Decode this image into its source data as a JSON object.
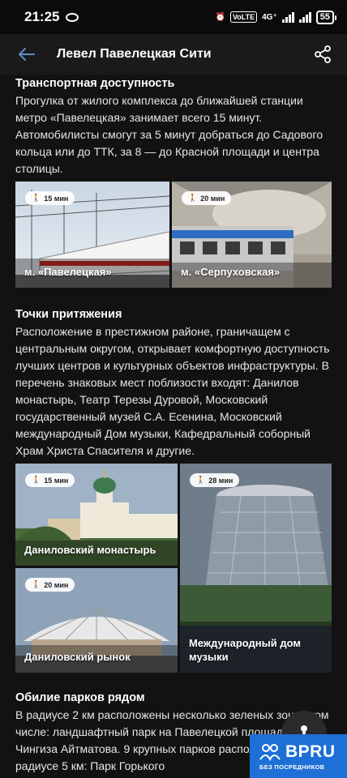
{
  "status_bar": {
    "time": "21:25",
    "volte": "VoLTE",
    "network": "4G⁺",
    "battery": "55"
  },
  "app_bar": {
    "title": "Левел Павелецкая Сити"
  },
  "transport": {
    "title": "Транспортная доступность",
    "text": "Прогулка от жилого комплекса до ближайшей станции метро «Павелецкая» занимает всего 15 минут. Автомобилисты смогут за 5 минут добраться до Садового кольца или до ТТК, за 8 — до Красной площади и центра столицы.",
    "tiles": [
      {
        "time": "15 мин",
        "label": "м. «Павелецкая»"
      },
      {
        "time": "20 мин",
        "label": "м. «Серпуховская»"
      }
    ]
  },
  "attractions": {
    "title": "Точки притяжения",
    "text": "Расположение в престижном районе, граничащем с центральным округом, открывает комфортную доступность лучших центров и культурных объектов инфраструктуры. В перечень знаковых мест поблизости входят: Данилов монастырь, Театр Терезы Дуровой, Московский государственный музей С.А. Есенина, Московский международный Дом музыки, Кафедральный соборный Храм Христа Спасителя и другие.",
    "tiles": [
      {
        "time": "15 мин",
        "label": "Даниловский монастырь"
      },
      {
        "time": "28 мин",
        "label": "Международный дом музыки"
      },
      {
        "time": "20 мин",
        "label": "Даниловский рынок"
      }
    ]
  },
  "parks": {
    "title": "Обилие парков рядом",
    "text": "В радиусе 2 км расположены несколько зеленых зон, в том числе: ландшафтный парк на Павелецкой площади, сквер Чингиза Айтматова. 9 крупных парков расположены в радиусе 5 км: Парк Горького"
  },
  "watermark": {
    "logo": "BPRU",
    "sub": "БЕЗ ПОСРЕДНИКОВ"
  },
  "colors": {
    "background": "#121212",
    "app_bar": "#1a1a1a",
    "watermark": "#1e6fd6"
  },
  "icons": [
    "back-arrow-icon",
    "share-icon",
    "walk-icon",
    "chat-icon",
    "people-icon"
  ]
}
